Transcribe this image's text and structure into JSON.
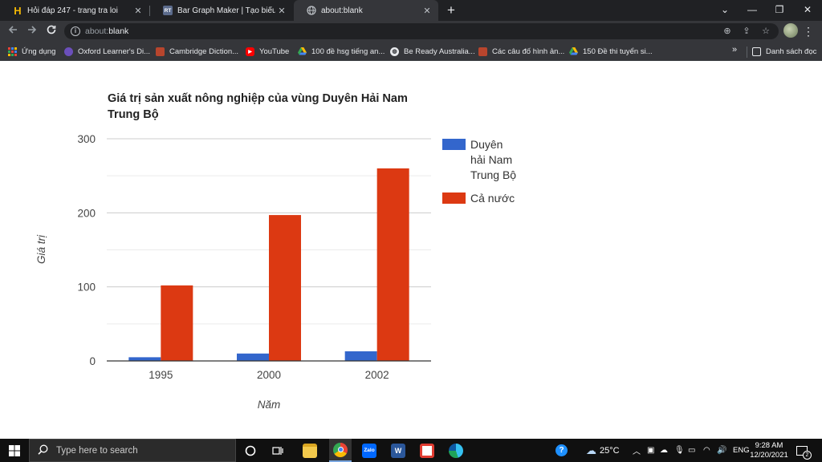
{
  "browser": {
    "tabs": [
      {
        "title": "Hỏi đáp 247 - trang tra loi",
        "favicon": "hoidap247-logo-icon",
        "active": false
      },
      {
        "title": "Bar Graph Maker | Tạo biểu đồ th",
        "favicon": "rt-logo-icon",
        "active": false
      },
      {
        "title": "about:blank",
        "favicon": "globe-icon",
        "active": true
      }
    ],
    "new_tab_label": "+",
    "window_controls": {
      "minimize": "—",
      "restore": "❐",
      "close": "✕"
    },
    "url": "about:blank",
    "url_scheme": "about:",
    "url_rest": "blank"
  },
  "bookmarks": {
    "items": [
      {
        "label": "Ứng dụng",
        "icon": "apps-grid-icon"
      },
      {
        "label": "Oxford Learner's Di...",
        "icon": "oxford-icon"
      },
      {
        "label": "Cambridge Diction...",
        "icon": "cambridge-icon"
      },
      {
        "label": "YouTube",
        "icon": "youtube-icon"
      },
      {
        "label": "100 đề hsg tiếng an...",
        "icon": "drive-icon"
      },
      {
        "label": "Be Ready Australia...",
        "icon": "globe-icon"
      },
      {
        "label": "Các câu đố hình ản...",
        "icon": "cambridge-icon"
      },
      {
        "label": "150 Đề thi tuyển si...",
        "icon": "drive-icon"
      }
    ],
    "more_label": "»",
    "reading_list_label": "Danh sách đọc"
  },
  "chart_data": {
    "type": "bar",
    "title_lines": [
      "Giá trị sản xuất nông nghiệp của vùng Duyên Hải Nam",
      "Trung Bộ"
    ],
    "categories": [
      "1995",
      "2000",
      "2002"
    ],
    "series": [
      {
        "name": "Duyên hải Nam Trung Bộ",
        "name_lines": [
          "Duyên",
          "hải Nam",
          "Trung Bộ"
        ],
        "color": "#3366cc",
        "values": [
          5,
          10,
          13
        ]
      },
      {
        "name": "Cả nước",
        "name_lines": [
          "Cả nước"
        ],
        "color": "#dc3912",
        "values": [
          102,
          197,
          260
        ]
      }
    ],
    "xlabel": "Năm",
    "ylabel": "Giá trị",
    "ylim": [
      0,
      300
    ],
    "yticks": [
      "0",
      "100",
      "200",
      "300"
    ],
    "grid": true,
    "legend_position": "right"
  },
  "taskbar": {
    "search_placeholder": "Type here to search",
    "apps": [
      "task-view-icon",
      "file-explorer-icon",
      "chrome-icon",
      "zalo-icon",
      "word-icon",
      "snipping-icon",
      "edge-icon"
    ],
    "weather": "25°C",
    "language": "ENG",
    "time": "9:28 AM",
    "date": "12/20/2021",
    "notification_count": "2"
  }
}
